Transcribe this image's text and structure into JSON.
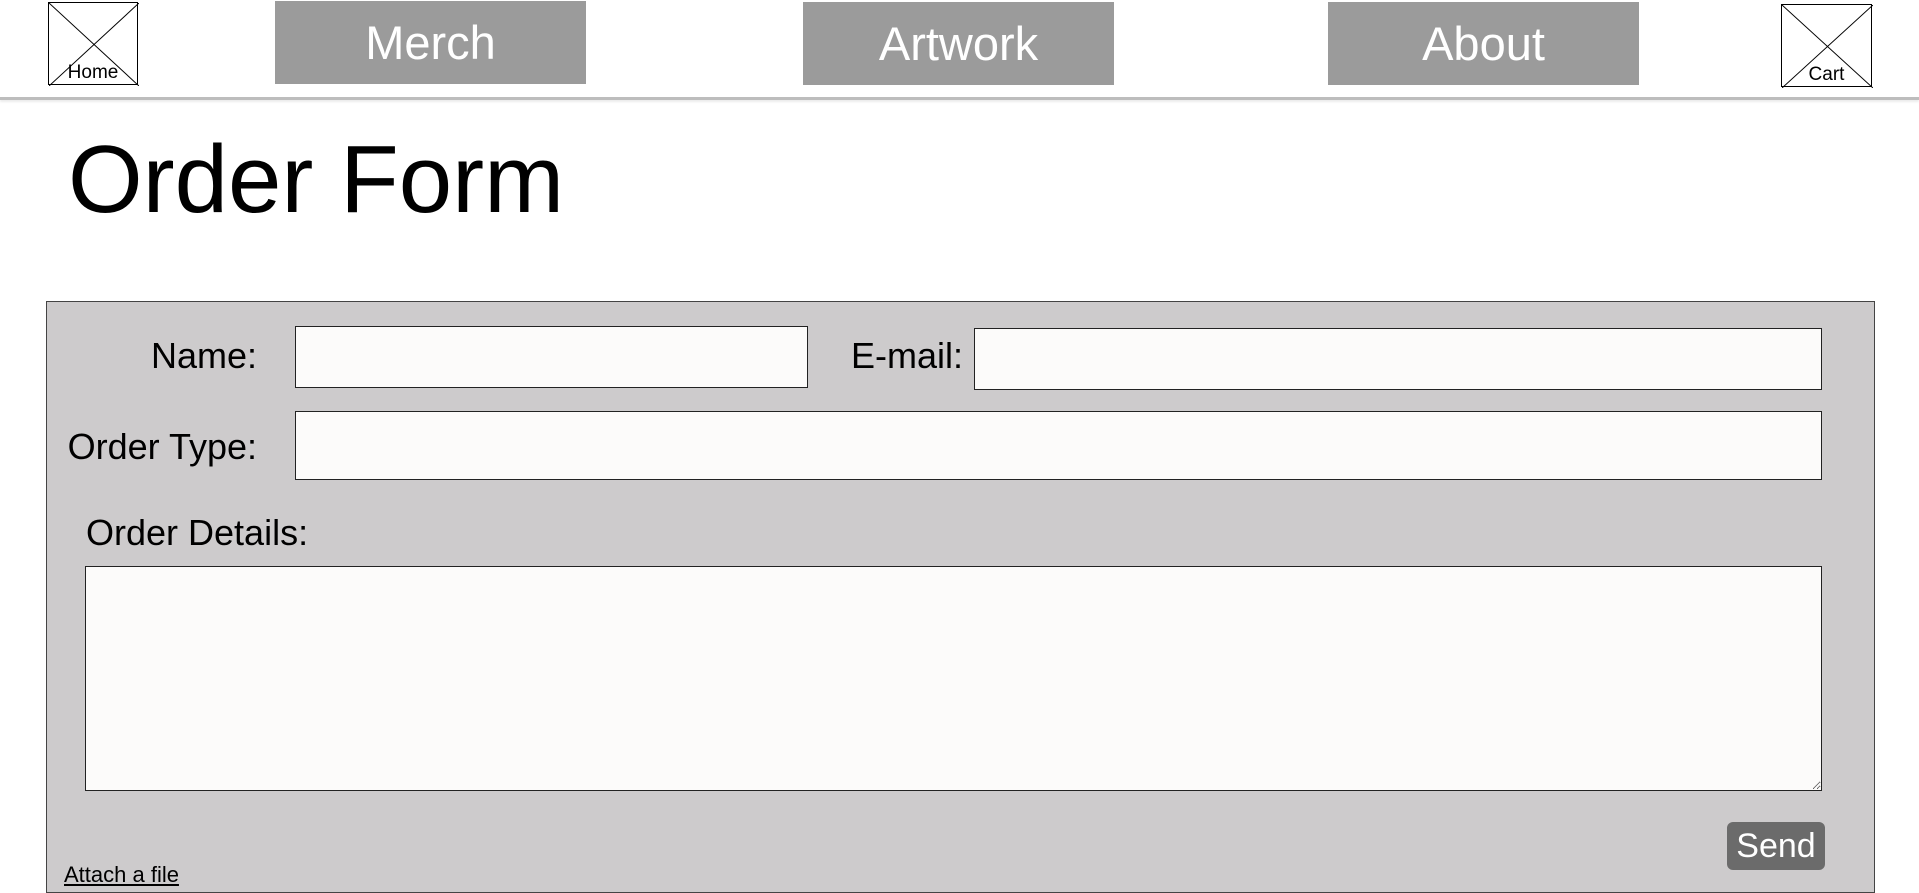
{
  "nav": {
    "home_label": "Home",
    "cart_label": "Cart",
    "merch_label": "Merch",
    "artwork_label": "Artwork",
    "about_label": "About"
  },
  "page": {
    "title": "Order Form"
  },
  "form": {
    "name_label": "Name:",
    "name_value": "",
    "email_label": "E-mail:",
    "email_value": "",
    "order_type_label": "Order Type:",
    "order_type_value": "",
    "order_details_label": "Order Details:",
    "order_details_value": "",
    "send_label": "Send",
    "attach_label": "Attach a file"
  },
  "colors": {
    "nav_button_bg": "#9b9b9b",
    "panel_bg": "#cdcbcc",
    "field_bg": "#fcfbfa",
    "send_bg": "#6b6b6b"
  },
  "icons": {
    "home": "image-placeholder-icon",
    "cart": "image-placeholder-icon"
  }
}
